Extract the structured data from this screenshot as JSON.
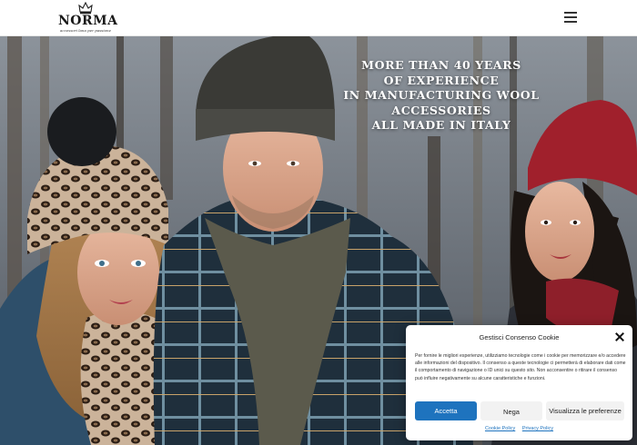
{
  "header": {
    "logo_text": "NORMA",
    "logo_tagline": "accessori lana per passione",
    "menu_icon": "hamburger-menu-icon"
  },
  "hero": {
    "headline_lines": [
      "More than 40 years",
      "of experience",
      "in manufacturing wool",
      "accessories",
      "all made in Italy"
    ]
  },
  "cookie_banner": {
    "title": "Gestisci Consenso Cookie",
    "body": "Per fornire le migliori esperienze, utilizziamo tecnologie come i cookie per memorizzare e/o accedere alle informazioni del dispositivo. Il consenso a queste tecnologie ci permetterà di elaborare dati come il comportamento di navigazione o ID unici su questo sito. Non acconsentire o ritirare il consenso può influire negativamente su alcune caratteristiche e funzioni.",
    "accept_label": "Accetta",
    "deny_label": "Nega",
    "preferences_label": "Visualizza le preferenze",
    "cookie_policy_label": "Cookie Policy",
    "privacy_policy_label": "Privacy Policy",
    "close_icon": "close-icon"
  },
  "colors": {
    "accent": "#1e73be",
    "header_bg": "#ffffff",
    "text_dark": "#222222"
  }
}
